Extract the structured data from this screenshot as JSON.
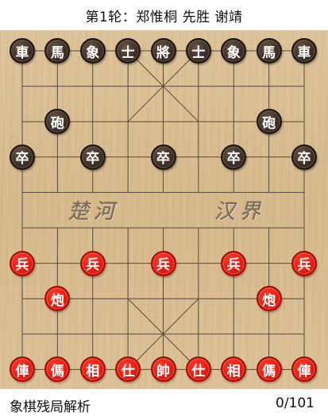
{
  "header": {
    "title": "第1轮：郑惟桐 先胜 谢靖"
  },
  "board": {
    "river_left": "楚河",
    "river_right": "汉界",
    "pieces": [
      {
        "side": "black",
        "char": "車",
        "file": 0,
        "rank": 0
      },
      {
        "side": "black",
        "char": "馬",
        "file": 1,
        "rank": 0
      },
      {
        "side": "black",
        "char": "象",
        "file": 2,
        "rank": 0
      },
      {
        "side": "black",
        "char": "士",
        "file": 3,
        "rank": 0
      },
      {
        "side": "black",
        "char": "將",
        "file": 4,
        "rank": 0
      },
      {
        "side": "black",
        "char": "士",
        "file": 5,
        "rank": 0
      },
      {
        "side": "black",
        "char": "象",
        "file": 6,
        "rank": 0
      },
      {
        "side": "black",
        "char": "馬",
        "file": 7,
        "rank": 0
      },
      {
        "side": "black",
        "char": "車",
        "file": 8,
        "rank": 0
      },
      {
        "side": "black",
        "char": "砲",
        "file": 1,
        "rank": 2
      },
      {
        "side": "black",
        "char": "砲",
        "file": 7,
        "rank": 2
      },
      {
        "side": "black",
        "char": "卒",
        "file": 0,
        "rank": 3
      },
      {
        "side": "black",
        "char": "卒",
        "file": 2,
        "rank": 3
      },
      {
        "side": "black",
        "char": "卒",
        "file": 4,
        "rank": 3
      },
      {
        "side": "black",
        "char": "卒",
        "file": 6,
        "rank": 3
      },
      {
        "side": "black",
        "char": "卒",
        "file": 8,
        "rank": 3
      },
      {
        "side": "red",
        "char": "兵",
        "file": 0,
        "rank": 6
      },
      {
        "side": "red",
        "char": "兵",
        "file": 2,
        "rank": 6
      },
      {
        "side": "red",
        "char": "兵",
        "file": 4,
        "rank": 6
      },
      {
        "side": "red",
        "char": "兵",
        "file": 6,
        "rank": 6
      },
      {
        "side": "red",
        "char": "兵",
        "file": 8,
        "rank": 6
      },
      {
        "side": "red",
        "char": "炮",
        "file": 1,
        "rank": 7
      },
      {
        "side": "red",
        "char": "炮",
        "file": 7,
        "rank": 7
      },
      {
        "side": "red",
        "char": "俥",
        "file": 0,
        "rank": 9
      },
      {
        "side": "red",
        "char": "傌",
        "file": 1,
        "rank": 9
      },
      {
        "side": "red",
        "char": "相",
        "file": 2,
        "rank": 9
      },
      {
        "side": "red",
        "char": "仕",
        "file": 3,
        "rank": 9
      },
      {
        "side": "red",
        "char": "帥",
        "file": 4,
        "rank": 9
      },
      {
        "side": "red",
        "char": "仕",
        "file": 5,
        "rank": 9
      },
      {
        "side": "red",
        "char": "相",
        "file": 6,
        "rank": 9
      },
      {
        "side": "red",
        "char": "傌",
        "file": 7,
        "rank": 9
      },
      {
        "side": "red",
        "char": "俥",
        "file": 8,
        "rank": 9
      }
    ]
  },
  "footer": {
    "title": "象棋残局解析",
    "move_counter": "0/101"
  },
  "colors": {
    "board_wood": "#d8bc8f",
    "grid_line": "#5a4a3a",
    "red_piece": "#e41c10",
    "black_piece": "#3d2f26"
  }
}
